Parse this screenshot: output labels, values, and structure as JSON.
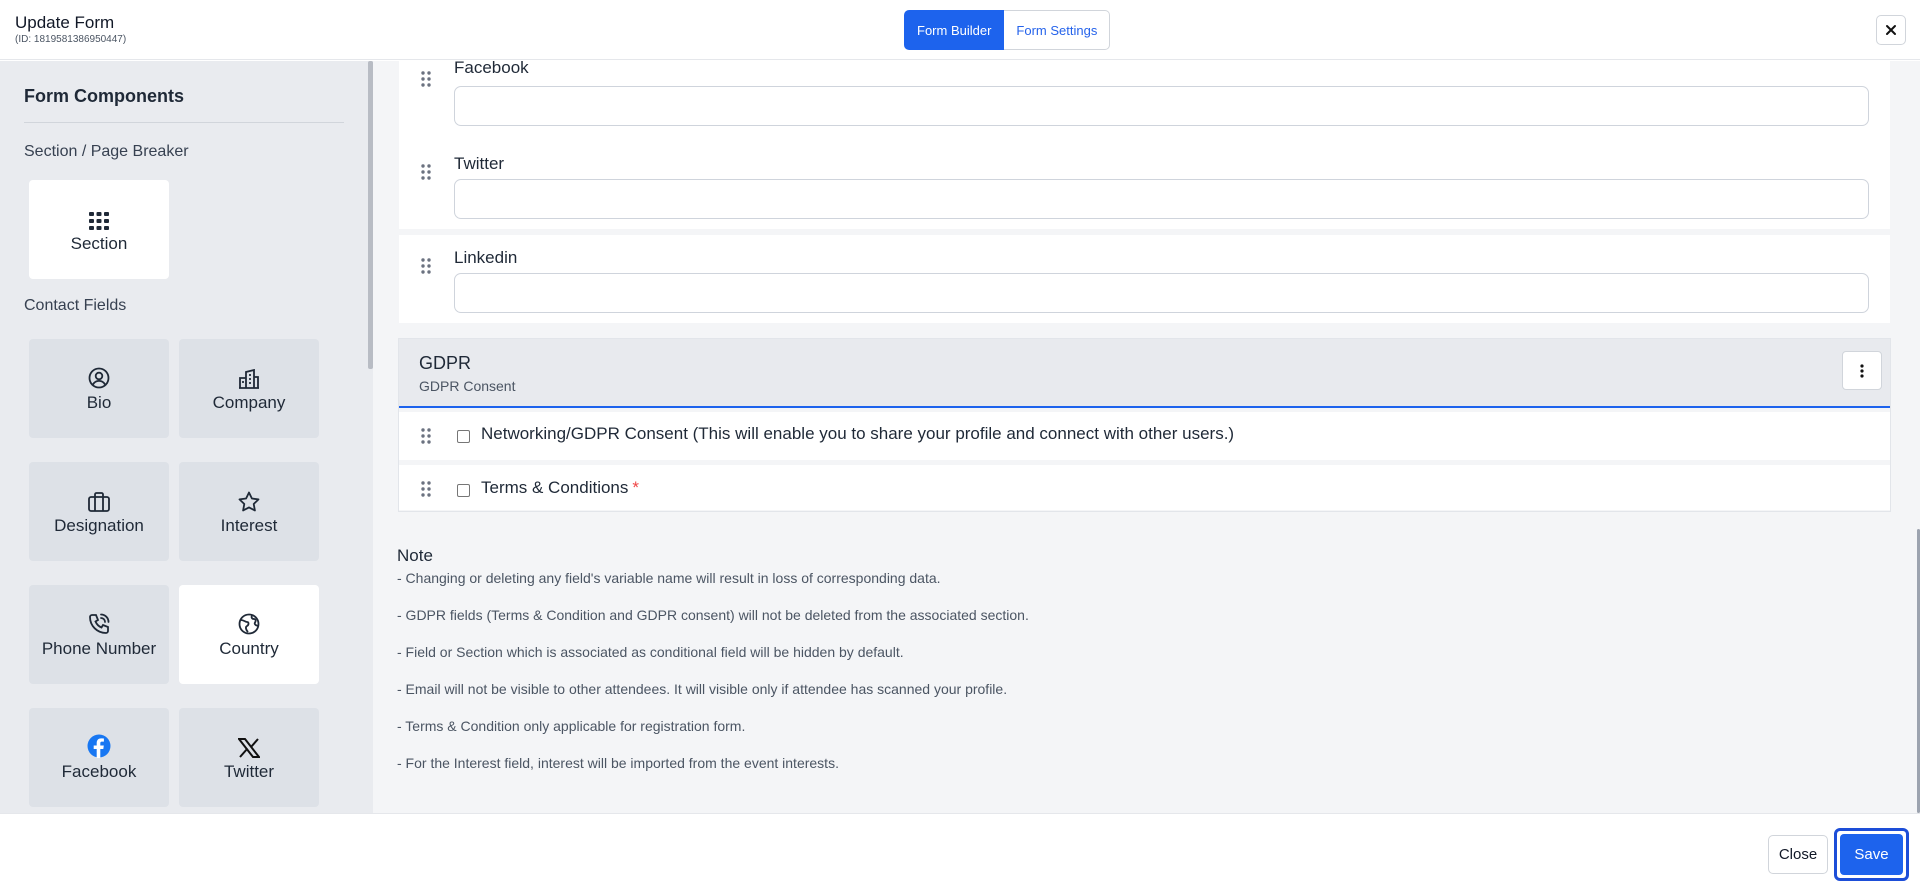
{
  "header": {
    "title": "Update Form",
    "subtitle": "(ID: 1819581386950447)",
    "tabs": [
      {
        "label": "Form Builder",
        "active": true
      },
      {
        "label": "Form Settings",
        "active": false
      }
    ],
    "close_icon": "close-icon"
  },
  "sidebar": {
    "heading": "Form Components",
    "groups": [
      {
        "label": "Section / Page Breaker"
      },
      {
        "label": "Contact Fields"
      }
    ],
    "items": [
      {
        "label": "Section",
        "icon": "grid-icon"
      },
      {
        "label": "Bio",
        "icon": "user-circle-icon"
      },
      {
        "label": "Company",
        "icon": "building-icon"
      },
      {
        "label": "Designation",
        "icon": "briefcase-icon"
      },
      {
        "label": "Interest",
        "icon": "star-icon"
      },
      {
        "label": "Phone Number",
        "icon": "phone-icon"
      },
      {
        "label": "Country",
        "icon": "globe-icon"
      },
      {
        "label": "Facebook",
        "icon": "facebook-icon"
      },
      {
        "label": "Twitter",
        "icon": "x-logo-icon"
      }
    ]
  },
  "main": {
    "fields": [
      {
        "label": "Facebook",
        "value": ""
      },
      {
        "label": "Twitter",
        "value": ""
      },
      {
        "label": "Linkedin",
        "value": ""
      }
    ],
    "gdpr": {
      "title": "GDPR",
      "subtitle": "GDPR Consent",
      "items": [
        {
          "label": "Networking/GDPR Consent (This will enable you to share your profile and connect with other users.)",
          "checked": false,
          "required": false
        },
        {
          "label": "Terms & Conditions",
          "checked": false,
          "required": true,
          "required_mark": "*"
        }
      ]
    },
    "note": {
      "title": "Note",
      "lines": [
        "- Changing or deleting any field's variable name will result in loss of corresponding data.",
        "- GDPR fields (Terms & Condition and GDPR consent) will not be deleted from the associated section.",
        "- Field or Section which is associated as conditional field will be hidden by default.",
        "- Email will not be visible to other attendees. It will visible only if attendee has scanned your profile.",
        "- Terms & Condition only applicable for registration form.",
        "- For the Interest field, interest will be imported from the event interests."
      ]
    }
  },
  "footer": {
    "close_label": "Close",
    "save_label": "Save"
  },
  "colors": {
    "accent": "#1d63ed",
    "sidebar_bg": "#e9ebef",
    "main_bg": "#f4f5f7",
    "required": "#ef4444",
    "facebook_brand": "#1877f2"
  }
}
